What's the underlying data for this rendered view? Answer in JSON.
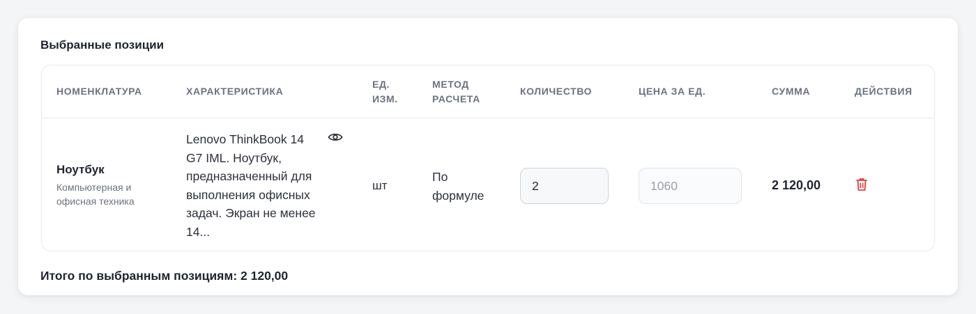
{
  "section": {
    "title": "Выбранные позиции"
  },
  "table": {
    "headers": {
      "nomenclature": "НОМЕНКЛАТУРА",
      "characteristic": "ХАРАКТЕРИСТИКА",
      "unit": "ЕД. ИЗМ.",
      "method": "МЕТОД РАСЧЕТА",
      "quantity": "КОЛИЧЕСТВО",
      "price": "ЦЕНА ЗА ЕД.",
      "sum": "СУММА",
      "actions": "ДЕЙСТВИЯ"
    },
    "rows": [
      {
        "name": "Ноутбук",
        "category": "Компьютерная и офисная техника",
        "characteristic": "Lenovo ThinkBook 14 G7 IML. Ноутбук, предназначенный для выполнения офисных задач. Экран не менее 14...",
        "unit": "шт",
        "method": "По формуле",
        "quantity": "2",
        "price_placeholder": "1060",
        "sum": "2 120,00"
      }
    ]
  },
  "total": {
    "text": "Итого по выбранным позициям: 2 120,00"
  },
  "icons": {
    "view": "eye-icon",
    "delete": "trash-icon"
  },
  "colors": {
    "delete": "#e23b3b",
    "header_text": "#6b7280"
  }
}
